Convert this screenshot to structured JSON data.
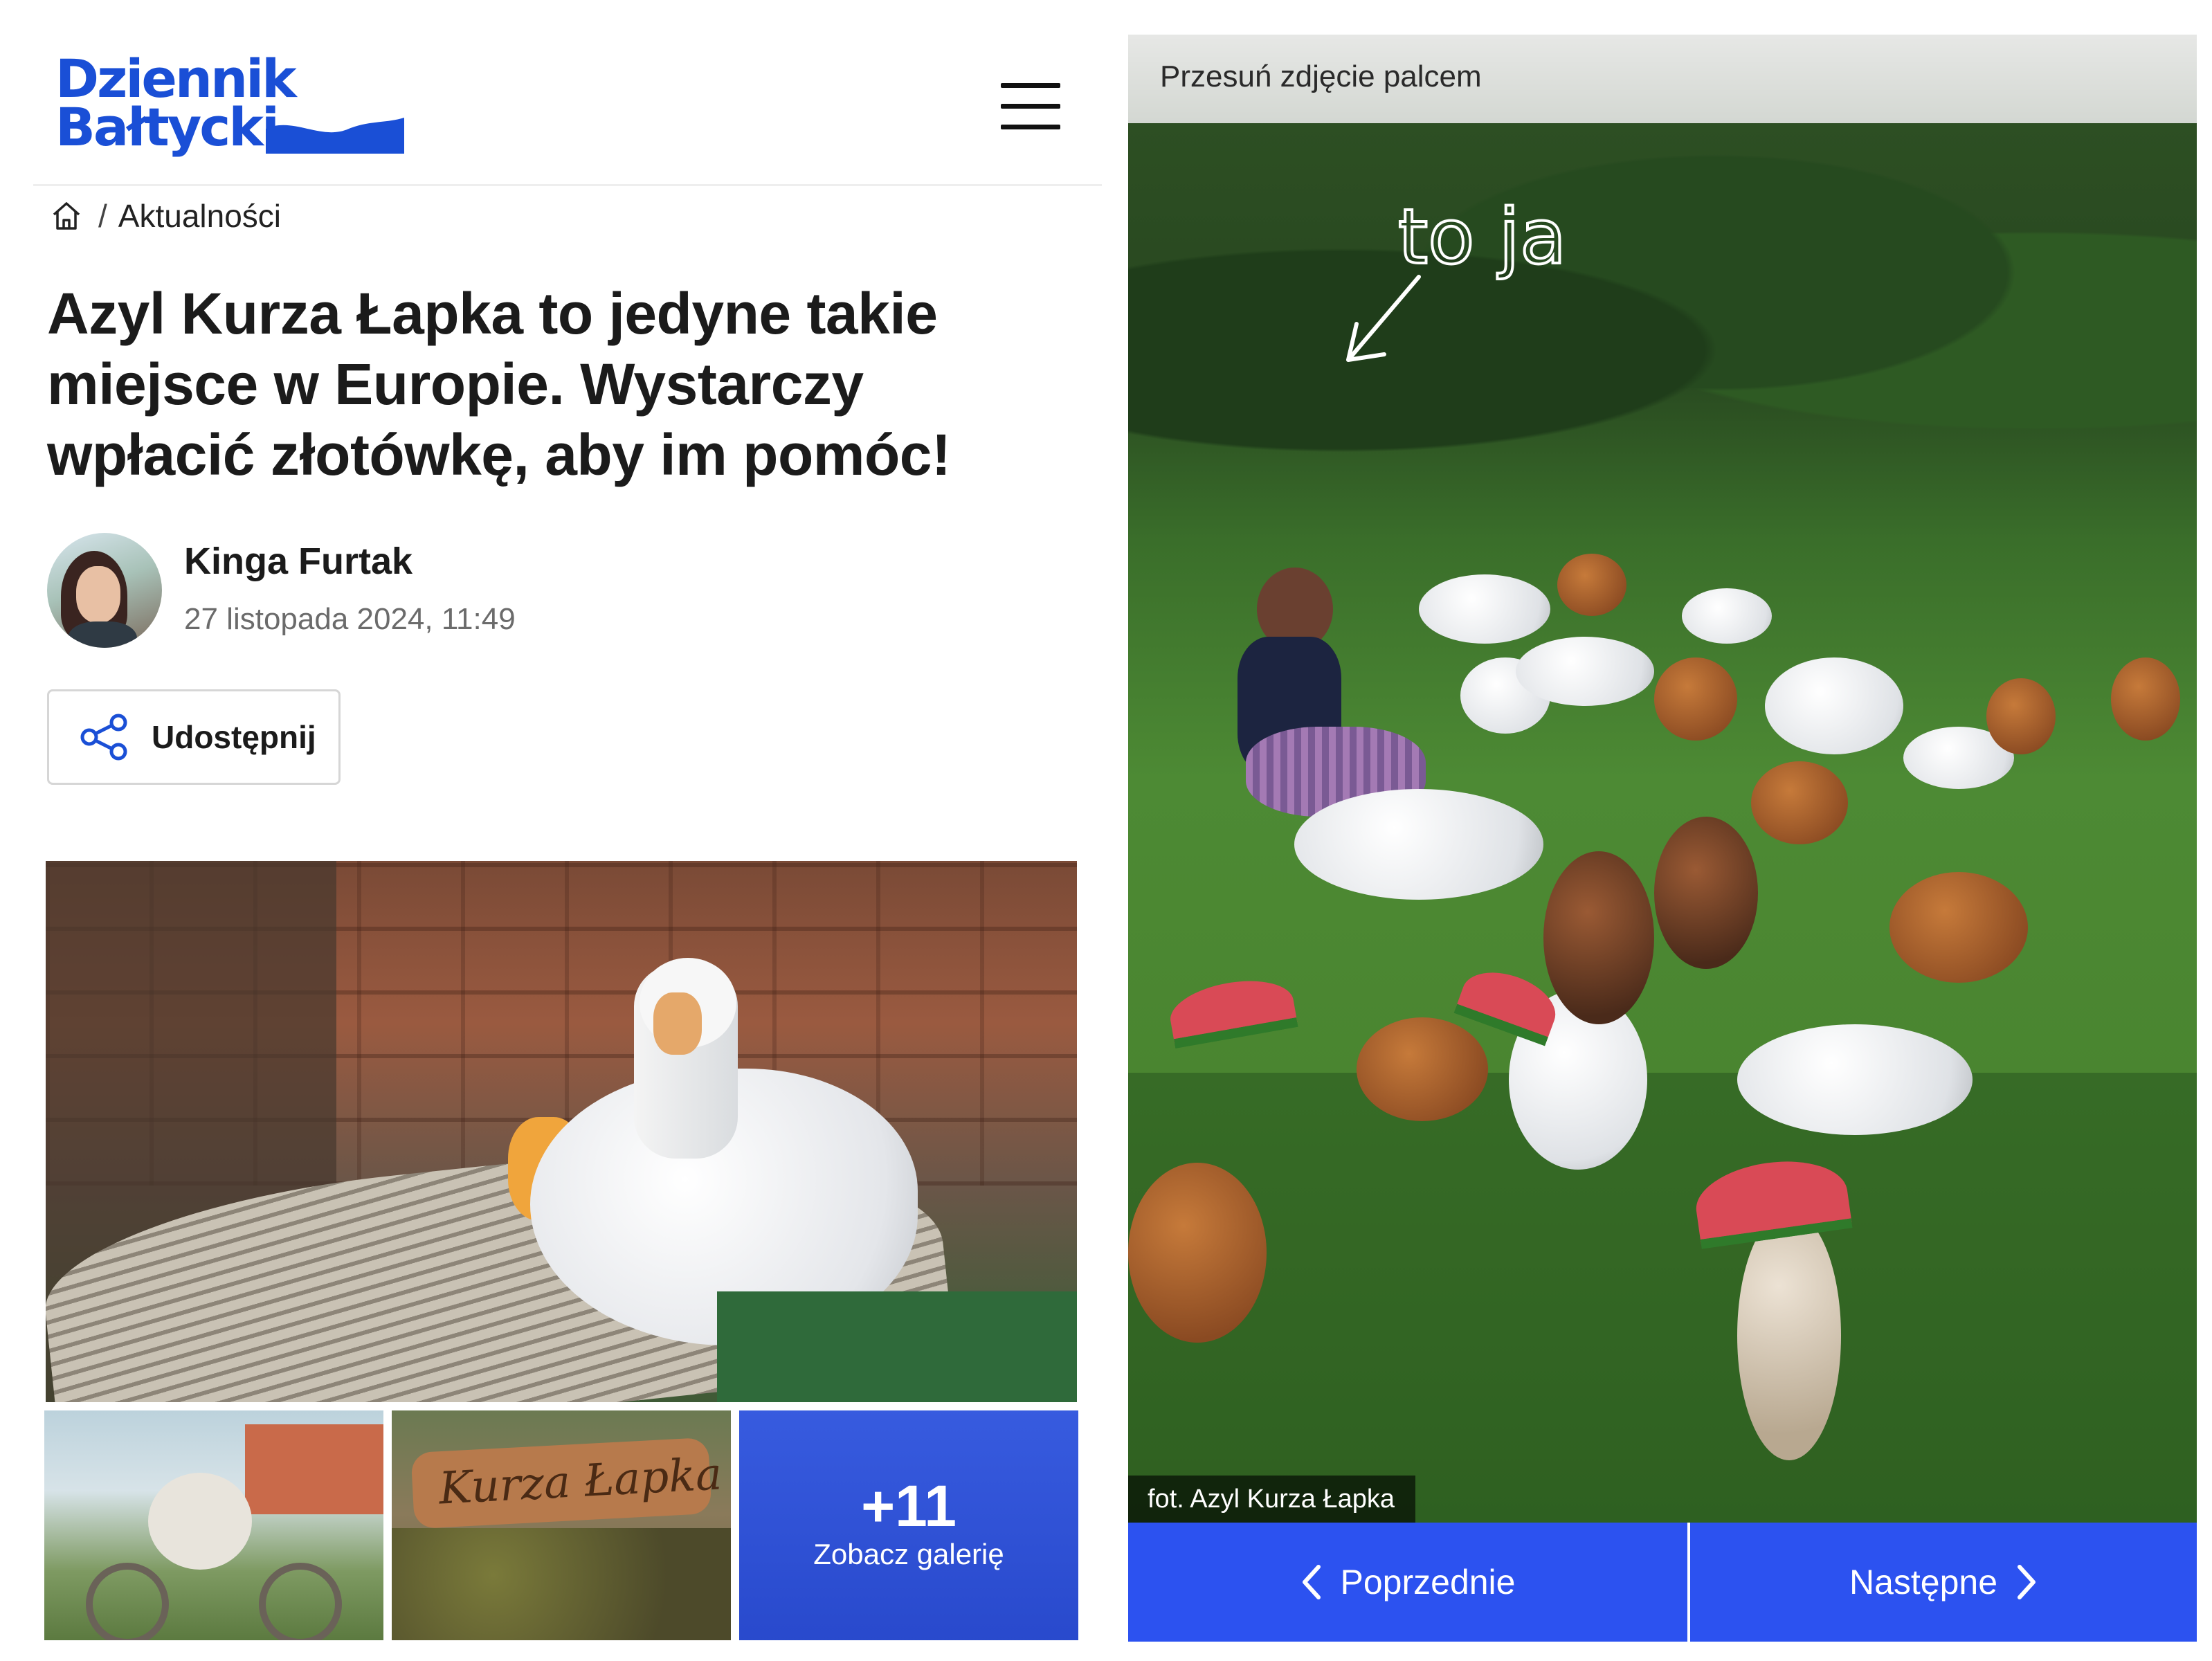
{
  "brand": {
    "logo_line1": "Dziennik",
    "logo_line2": "Bałtycki",
    "brand_color": "#1a4fd6",
    "accent_color": "#2c52f0"
  },
  "header": {
    "menu_icon": "hamburger-menu-icon"
  },
  "breadcrumb": {
    "home_icon": "home-icon",
    "separator": "/",
    "category": "Aktualności"
  },
  "article": {
    "title": "Azyl Kurza Łapka to jedyne takie miejsce w Europie. Wystarczy wpłacić złotówkę, aby im pomóc!",
    "author": {
      "name": "Kinga Furtak",
      "date": "27 listopada 2024, 11:49"
    },
    "share_label": "Udostępnij",
    "share_icon": "share-icon"
  },
  "gallery_preview": {
    "thumb2_sign_text": "Kurza Łapka",
    "more_count": "+11",
    "more_label": "Zobacz galerię"
  },
  "gallery_viewer": {
    "swipe_hint": "Przesuń zdjęcie palcem",
    "handwritten_note": "to ja",
    "photo_credit": "fot. Azyl Kurza Łapka",
    "prev_label": "Poprzednie",
    "next_label": "Następne",
    "prev_icon": "chevron-left-icon",
    "next_icon": "chevron-right-icon"
  }
}
